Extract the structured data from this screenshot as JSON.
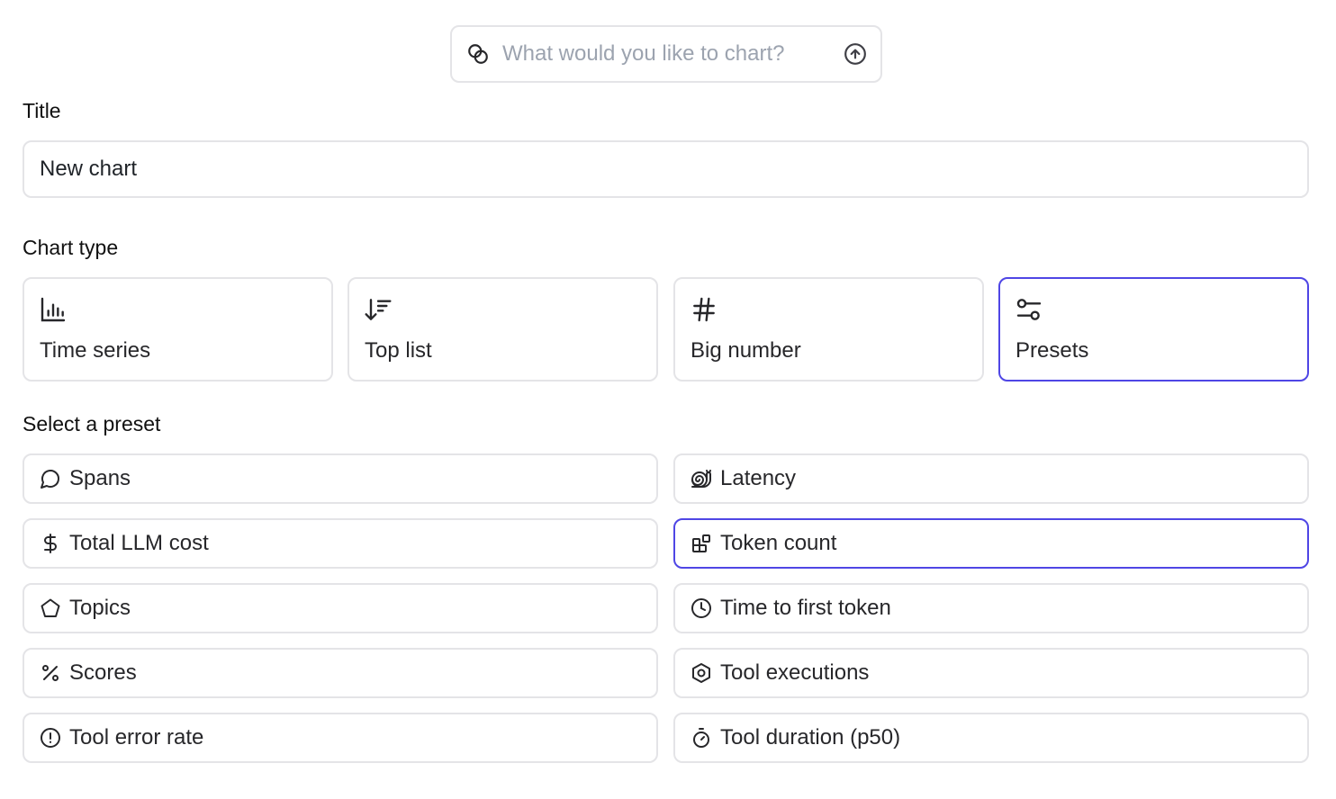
{
  "ask": {
    "placeholder": "What would you like to chart?",
    "lead_icon": "overlapping-circles-icon",
    "submit_icon": "arrow-up-circle-icon"
  },
  "title_section": {
    "label": "Title",
    "value": "New chart"
  },
  "chart_type_section": {
    "label": "Chart type",
    "selected": "Presets",
    "options": [
      {
        "label": "Time series",
        "icon": "bar-chart-icon"
      },
      {
        "label": "Top list",
        "icon": "sort-descending-icon"
      },
      {
        "label": "Big number",
        "icon": "hash-icon"
      },
      {
        "label": "Presets",
        "icon": "presets-icon"
      }
    ]
  },
  "preset_section": {
    "label": "Select a preset",
    "selected": "Token count",
    "items": [
      {
        "label": "Spans",
        "icon": "message-circle-icon"
      },
      {
        "label": "Latency",
        "icon": "snail-icon"
      },
      {
        "label": "Total LLM cost",
        "icon": "dollar-icon"
      },
      {
        "label": "Token count",
        "icon": "blocks-icon"
      },
      {
        "label": "Topics",
        "icon": "pentagon-icon"
      },
      {
        "label": "Time to first token",
        "icon": "clock-icon"
      },
      {
        "label": "Scores",
        "icon": "percent-icon"
      },
      {
        "label": "Tool executions",
        "icon": "hexagon-icon"
      },
      {
        "label": "Tool error rate",
        "icon": "alert-circle-icon"
      },
      {
        "label": "Tool duration (p50)",
        "icon": "timer-icon"
      }
    ]
  },
  "colors": {
    "accent": "#4f46e5",
    "border": "#e4e4e7",
    "placeholder": "#9ca3af"
  }
}
